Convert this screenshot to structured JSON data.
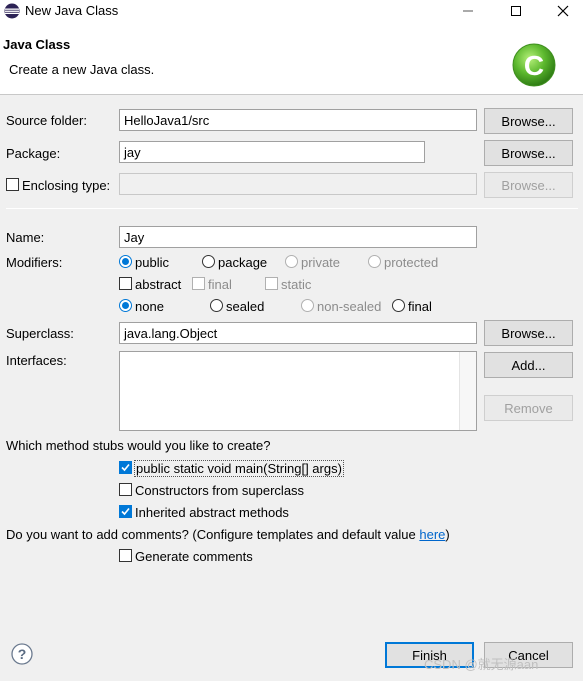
{
  "window": {
    "title": "New Java Class",
    "minimize_icon": "minimize-icon",
    "maximize_icon": "maximize-icon",
    "close_icon": "close-icon"
  },
  "banner": {
    "title": "Java Class",
    "description": "Create a new Java class.",
    "image_icon": "new-class-wizard-icon"
  },
  "form": {
    "source_folder": {
      "label": "Source folder:",
      "value": "HelloJava1/src",
      "button": "Browse..."
    },
    "package": {
      "label": "Package:",
      "value": "jay",
      "button": "Browse..."
    },
    "enclosing_type": {
      "label": "Enclosing type:",
      "checked": false,
      "value": "",
      "button": "Browse..."
    },
    "name": {
      "label": "Name:",
      "value": "Jay"
    },
    "modifiers": {
      "label": "Modifiers:",
      "access": [
        {
          "label": "public",
          "checked": true,
          "enabled": true
        },
        {
          "label": "package",
          "checked": false,
          "enabled": true
        },
        {
          "label": "private",
          "checked": false,
          "enabled": false
        },
        {
          "label": "protected",
          "checked": false,
          "enabled": false
        }
      ],
      "flags": [
        {
          "label": "abstract",
          "checked": false,
          "enabled": true
        },
        {
          "label": "final",
          "checked": false,
          "enabled": false
        },
        {
          "label": "static",
          "checked": false,
          "enabled": false
        }
      ],
      "sealing": [
        {
          "label": "none",
          "checked": true,
          "enabled": true
        },
        {
          "label": "sealed",
          "checked": false,
          "enabled": true
        },
        {
          "label": "non-sealed",
          "checked": false,
          "enabled": false
        },
        {
          "label": "final",
          "checked": false,
          "enabled": true
        }
      ]
    },
    "superclass": {
      "label": "Superclass:",
      "value": "java.lang.Object",
      "button": "Browse..."
    },
    "interfaces": {
      "label": "Interfaces:",
      "add_button": "Add...",
      "remove_button": "Remove"
    },
    "stubs": {
      "question": "Which method stubs would you like to create?",
      "options": [
        {
          "label": "public static void main(String[] args)",
          "checked": true
        },
        {
          "label": "Constructors from superclass",
          "checked": false
        },
        {
          "label": "Inherited abstract methods",
          "checked": true
        }
      ]
    },
    "comments": {
      "question_prefix": "Do you want to add comments? (Configure templates and default value ",
      "link": "here",
      "question_suffix": ")",
      "option": {
        "label": "Generate comments",
        "checked": false
      }
    }
  },
  "footer": {
    "help_icon": "help-icon",
    "finish": "Finish",
    "cancel": "Cancel",
    "watermark": "CSDN @就无源aan"
  },
  "colors": {
    "accent": "#0078d7",
    "logo_green": "#5cb82e",
    "link": "#0066cc"
  }
}
